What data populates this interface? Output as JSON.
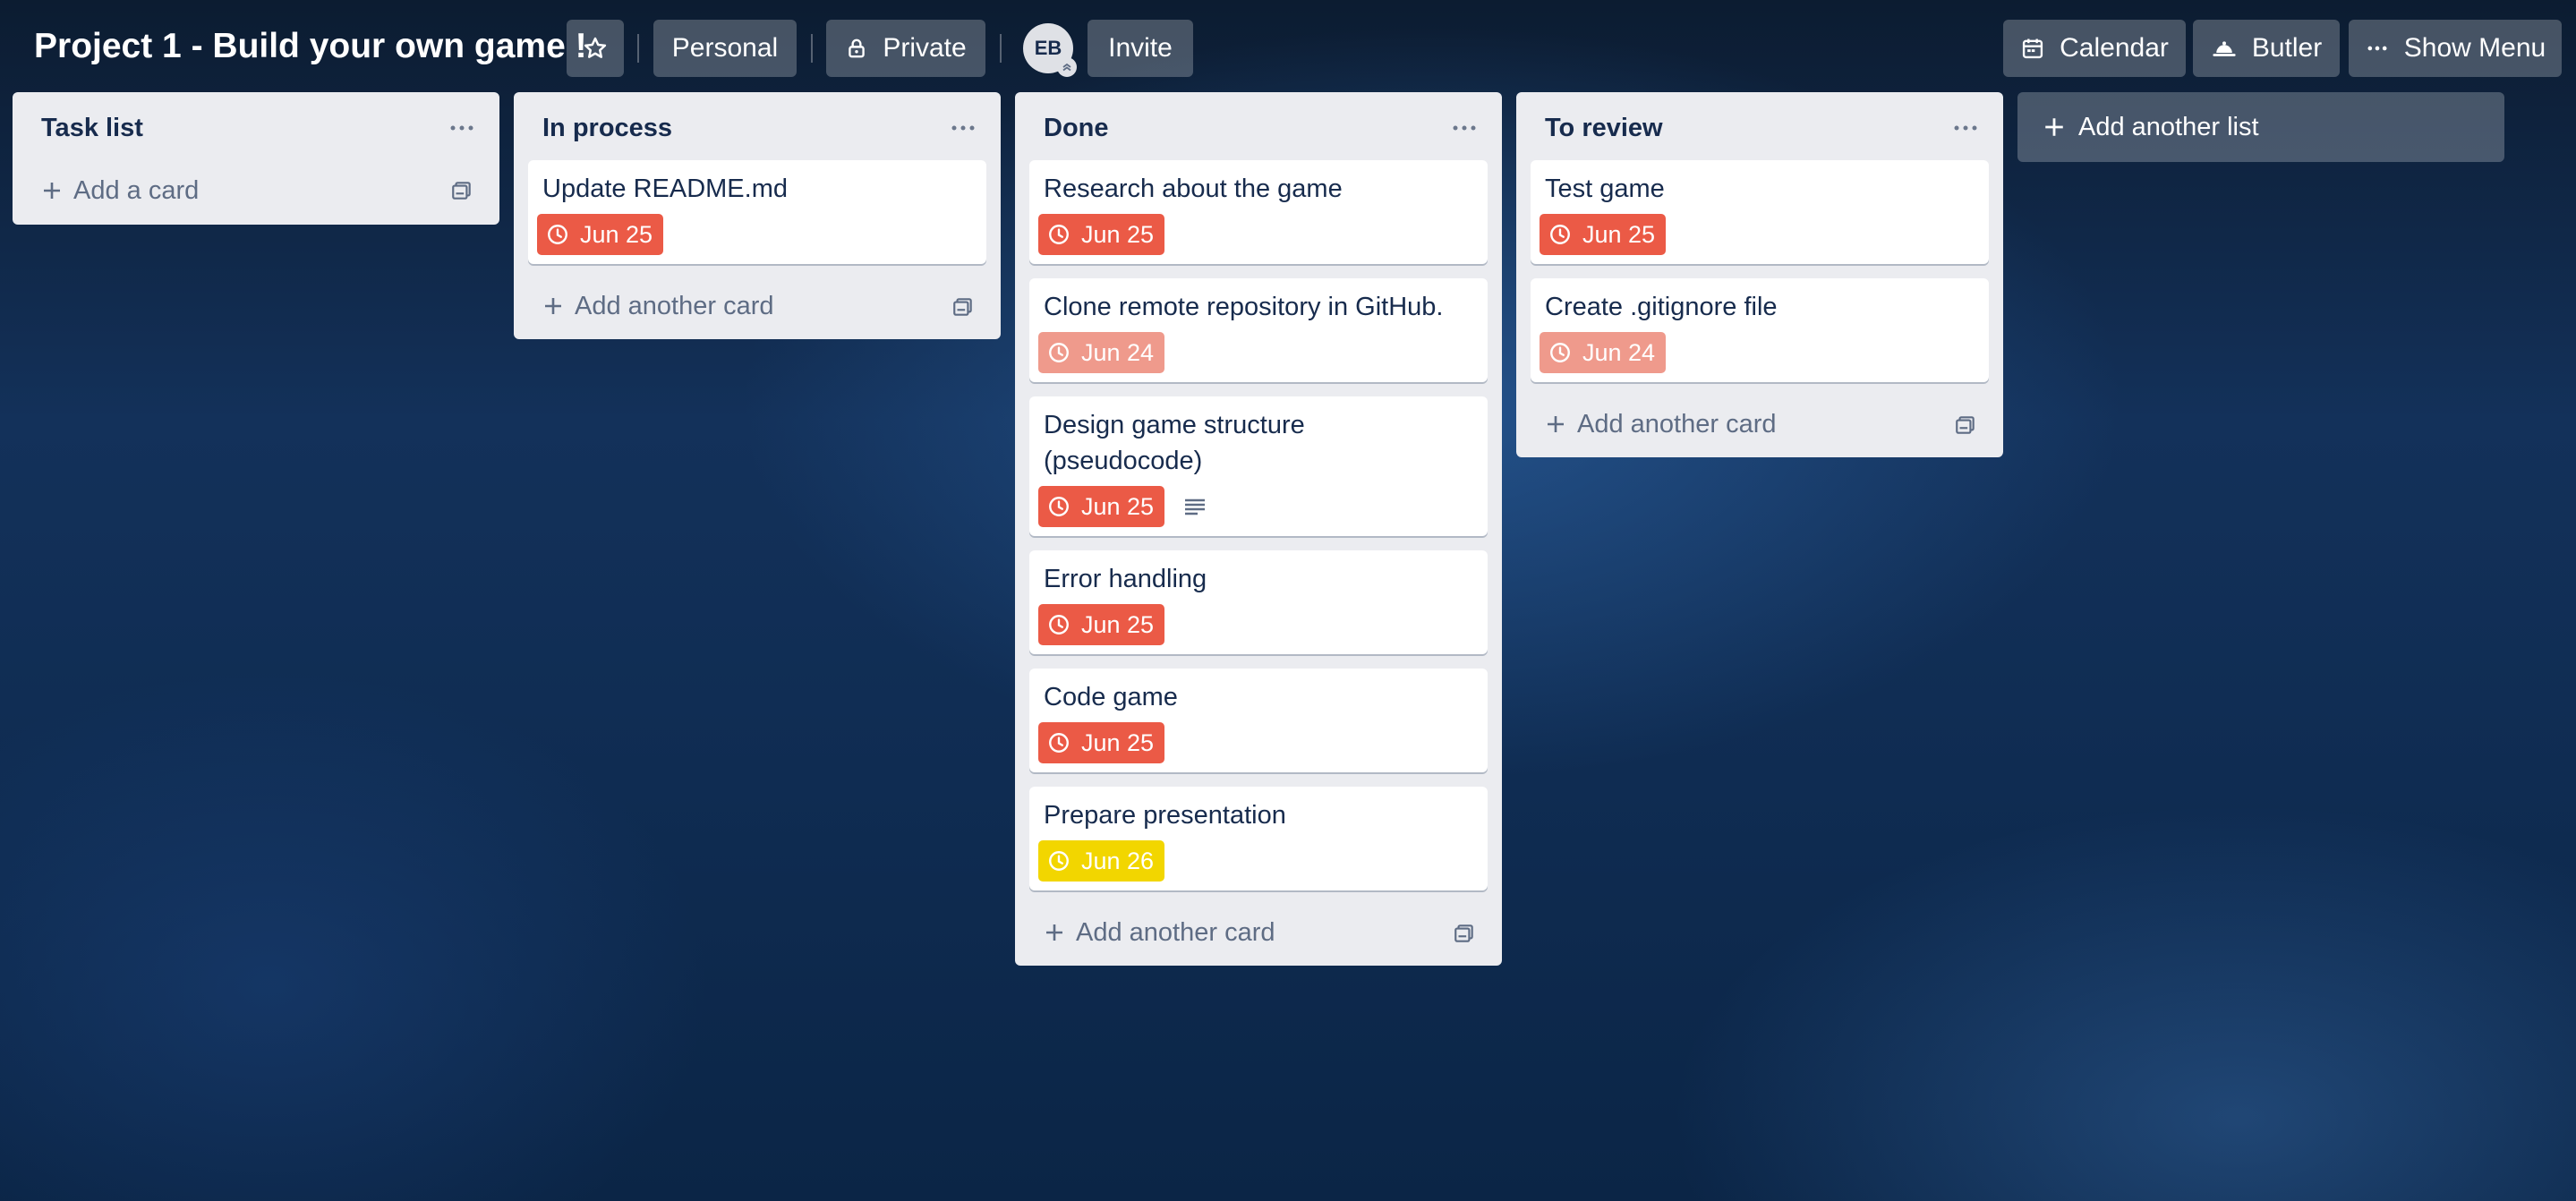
{
  "header": {
    "board_title": "Project 1 - Build your own game !",
    "star_icon": "star-icon",
    "visibility_team": "Personal",
    "visibility_privacy": "Private",
    "member_initials": "EB",
    "invite_label": "Invite",
    "calendar_label": "Calendar",
    "butler_label": "Butler",
    "show_menu_label": "Show Menu"
  },
  "colors": {
    "due_overdue": "#eb5a46",
    "due_past_complete": "#ef9a8c",
    "due_soon": "#f2d600",
    "list_bg": "#ebecf0",
    "board_bg": "#13315a"
  },
  "lists": [
    {
      "title": "Task list",
      "add_label": "Add a card",
      "cards": []
    },
    {
      "title": "In process",
      "add_label": "Add another card",
      "cards": [
        {
          "title": "Update README.md",
          "due": "Jun 25",
          "status": "overdue"
        }
      ]
    },
    {
      "title": "Done",
      "add_label": "Add another card",
      "cards": [
        {
          "title": "Research about the game",
          "due": "Jun 25",
          "status": "overdue"
        },
        {
          "title": "Clone remote repository in GitHub.",
          "due": "Jun 24",
          "status": "past"
        },
        {
          "title": "Design game structure (pseudocode)",
          "due": "Jun 25",
          "status": "overdue",
          "has_description": true
        },
        {
          "title": "Error handling",
          "due": "Jun 25",
          "status": "overdue"
        },
        {
          "title": "Code game",
          "due": "Jun 25",
          "status": "overdue"
        },
        {
          "title": "Prepare presentation",
          "due": "Jun 26",
          "status": "soon"
        }
      ]
    },
    {
      "title": "To review",
      "add_label": "Add another card",
      "cards": [
        {
          "title": "Test game",
          "due": "Jun 25",
          "status": "overdue"
        },
        {
          "title": "Create .gitignore file",
          "due": "Jun 24",
          "status": "past"
        }
      ]
    }
  ],
  "add_list_label": "Add another list"
}
